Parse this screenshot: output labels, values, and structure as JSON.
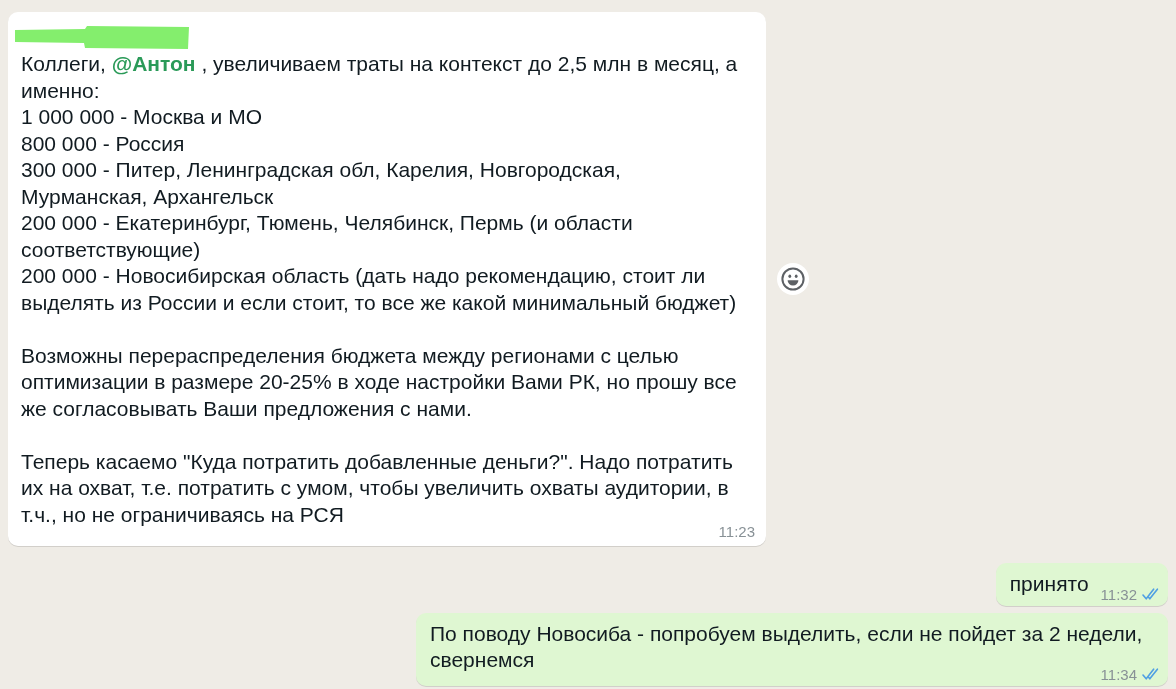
{
  "messages": [
    {
      "kind": "incoming",
      "sender_redacted": true,
      "show_reaction_button": true,
      "intro": [
        {
          "kind": "text",
          "text": "Коллеги, "
        },
        {
          "kind": "mention",
          "text": "@Антон"
        },
        {
          "kind": "text",
          "text": " , увеличиваем траты на контекст до 2,5 млн в месяц, а именно:"
        }
      ],
      "budget_lines": [
        "1 000 000 - Москва и МО",
        "800 000 - Россия",
        "300 000 - Питер, Ленинградская обл, Карелия, Новгородская, Мурманская, Архангельск",
        "200 000 - Екатеринбург, Тюмень, Челябинск, Пермь (и области соответствующие)",
        "200 000 - Новосибирская область (дать надо рекомендацию, стоит ли выделять из России и если стоит, то все же какой минимальный бюджет)"
      ],
      "paragraphs": [
        "Возможны перераспределения бюджета между регионами с целью оптимизации в размере 20-25% в ходе настройки Вами РК, но прошу все же согласовывать Ваши предложения с нами.",
        "Теперь касаемо \"Куда потратить добавленные деньги?\". Надо потратить их на охват, т.е. потратить с умом, чтобы увеличить охваты аудитории, в т.ч., но не ограничиваясь на РСЯ"
      ],
      "time": "11:23"
    },
    {
      "kind": "outgoing",
      "text": "принято",
      "time": "11:32",
      "read": true
    },
    {
      "kind": "outgoing",
      "text": "По поводу Новосиба - попробуем выделить, если не пойдет за 2 недели, свернемся",
      "time": "11:34",
      "read": true
    }
  ]
}
